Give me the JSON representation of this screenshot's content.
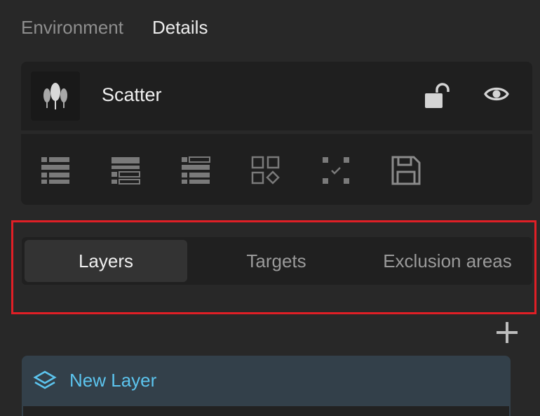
{
  "top_tabs": [
    {
      "label": "Environment",
      "active": false
    },
    {
      "label": "Details",
      "active": true
    }
  ],
  "object": {
    "name": "Scatter",
    "thumbnail_icon": "scatter-trees-icon",
    "lock_icon": "unlocked-padlock-icon",
    "visibility_icon": "eye-icon"
  },
  "toolbar": [
    {
      "icon": "list-icon"
    },
    {
      "icon": "list-indented-icon"
    },
    {
      "icon": "list-outline-icon"
    },
    {
      "icon": "shapes-grid-icon"
    },
    {
      "icon": "select-frame-check-icon"
    },
    {
      "icon": "save-icon"
    }
  ],
  "segmented_tabs": [
    {
      "label": "Layers",
      "active": true
    },
    {
      "label": "Targets",
      "active": false
    },
    {
      "label": "Exclusion areas",
      "active": false
    }
  ],
  "add_icon": "plus-icon",
  "layer": {
    "name": "New Layer",
    "icon": "layers-stack-icon"
  },
  "colors": {
    "background": "#282828",
    "panel": "#1f1f1f",
    "highlight_border": "#e01f26",
    "layer_card": "#33404a",
    "layer_name": "#5cc4ee"
  }
}
